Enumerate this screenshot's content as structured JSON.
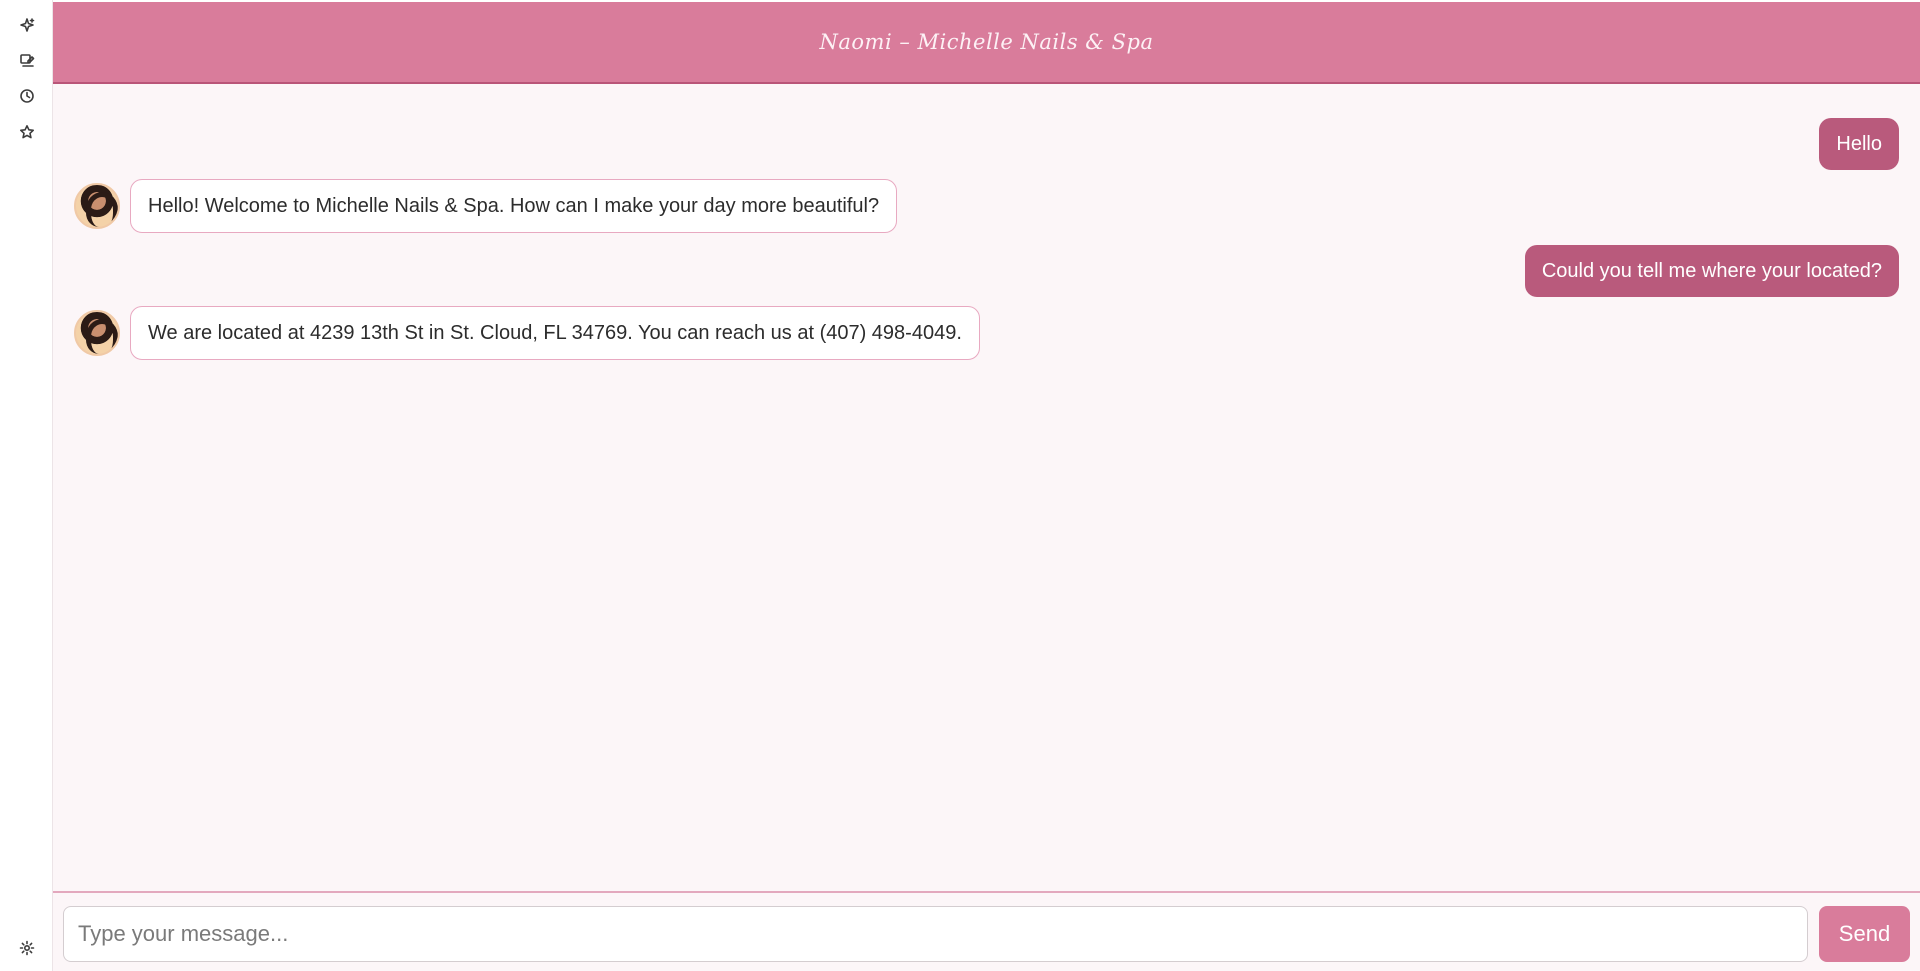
{
  "header": {
    "title": "Naomi – Michelle Nails & Spa"
  },
  "sidebar": {
    "icons": [
      {
        "name": "sparkle-icon"
      },
      {
        "name": "chat-edit-icon"
      },
      {
        "name": "history-icon"
      },
      {
        "name": "star-icon"
      }
    ],
    "bottom_icon": "settings-icon"
  },
  "messages": [
    {
      "role": "user",
      "text": "Hello"
    },
    {
      "role": "assistant",
      "text": "Hello! Welcome to Michelle Nails & Spa. How can I make your day more beautiful?"
    },
    {
      "role": "user",
      "text": "Could you tell me where your located?"
    },
    {
      "role": "assistant",
      "text": "We are located at 4239 13th St in St. Cloud, FL 34769. You can reach us at (407) 498-4049."
    }
  ],
  "composer": {
    "placeholder": "Type your message...",
    "value": "",
    "send_label": "Send"
  },
  "colors": {
    "header_bg": "#d97c9b",
    "user_bubble": "#b95a7c",
    "bot_border": "#e8a9c1",
    "page_bg": "#fcf6f8"
  }
}
